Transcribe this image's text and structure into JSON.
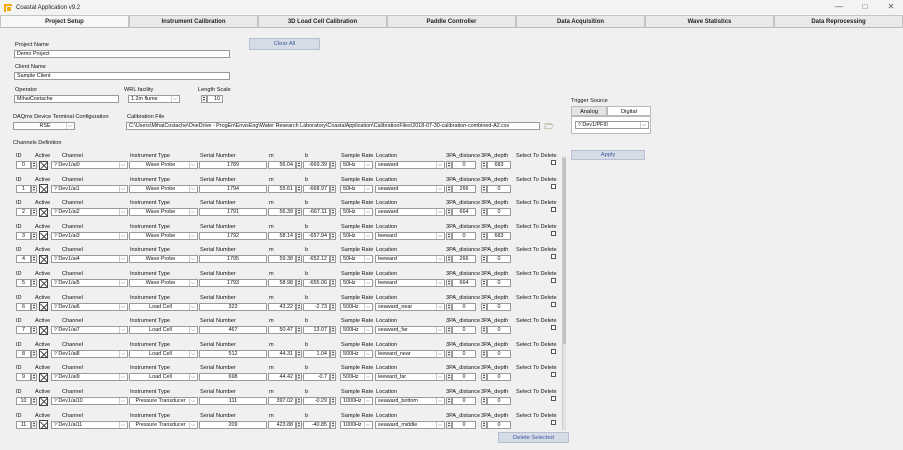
{
  "window": {
    "title": "Coastal Application v9.2",
    "minimize": "—",
    "maximize": "□",
    "close": "✕"
  },
  "tabs": [
    "Project Setup",
    "Instrument Calibration",
    "3D Load Cell Calibration",
    "Paddle Controller",
    "Data Acquisition",
    "Wave Statistics",
    "Data Reprocessing"
  ],
  "project": {
    "name_label": "Project Name",
    "name": "Demo Project",
    "client_label": "Client Name",
    "client": "Sample Client",
    "operator_label": "Operator",
    "operator": "MihaiCostache",
    "facility_label": "WRL facility",
    "facility": "1.2m flume",
    "length_label": "Length Scale",
    "length": "10",
    "clear_all": "Clear All"
  },
  "daq": {
    "label": "DAQmx Device Terminal Configuration",
    "value": "RSE"
  },
  "calibration": {
    "label": "Calibration File",
    "path": "C:\\Users\\MihaiCostache\\OneDrive - ProgEn\\EnvisEng\\Water Research Laboratory\\CoastalApplication\\CalibrationFiles\\2018-07-30-calibration-combined-A2.csv"
  },
  "trigger": {
    "label": "Trigger Source",
    "tab_analog": "Analog",
    "tab_digital": "Digital",
    "channel": "Dev1/PFI0",
    "apply": "Apply"
  },
  "channels": {
    "title": "Channels Definition",
    "headers": {
      "id": "ID",
      "active": "Active",
      "channel": "Channel",
      "instrument": "Instrument Type",
      "serial": "Serial Number",
      "m": "m",
      "b": "b",
      "rate": "Sample Rate",
      "location": "Location",
      "dist": "3PA_distance",
      "depth": "3PA_depth",
      "delete": "Select To Delete"
    },
    "rows": [
      {
        "id": "0",
        "channel": "Dev1/ai0",
        "instrument": "Wave Probe",
        "serial": "1789",
        "m": "56.04",
        "b": "-669.39",
        "rate": "50Hz",
        "location": "seaward",
        "dist": "0",
        "depth": "683"
      },
      {
        "id": "1",
        "channel": "Dev1/ai1",
        "instrument": "Wave Probe",
        "serial": "1794",
        "m": "55.61",
        "b": "-668.97",
        "rate": "50Hz",
        "location": "seaward",
        "dist": "266",
        "depth": "0"
      },
      {
        "id": "2",
        "channel": "Dev1/ai2",
        "instrument": "Wave Probe",
        "serial": "1791",
        "m": "56.39",
        "b": "-667.11",
        "rate": "50Hz",
        "location": "seaward",
        "dist": "664",
        "depth": "0"
      },
      {
        "id": "3",
        "channel": "Dev1/ai3",
        "instrument": "Wave Probe",
        "serial": "1792",
        "m": "58.14",
        "b": "-657.94",
        "rate": "50Hz",
        "location": "leeward",
        "dist": "0",
        "depth": "683"
      },
      {
        "id": "4",
        "channel": "Dev1/ai4",
        "instrument": "Wave Probe",
        "serial": "1795",
        "m": "59.38",
        "b": "-652.12",
        "rate": "50Hz",
        "location": "leeward",
        "dist": "266",
        "depth": "0"
      },
      {
        "id": "5",
        "channel": "Dev1/ai5",
        "instrument": "Wave Probe",
        "serial": "1793",
        "m": "58.98",
        "b": "-655.06",
        "rate": "50Hz",
        "location": "leeward",
        "dist": "664",
        "depth": "0"
      },
      {
        "id": "6",
        "channel": "Dev1/ai6",
        "instrument": "Load Cell",
        "serial": "323",
        "m": "43.22",
        "b": "-2.73",
        "rate": "500Hz",
        "location": "seaward_near",
        "dist": "0",
        "depth": "0"
      },
      {
        "id": "7",
        "channel": "Dev1/ai7",
        "instrument": "Load Cell",
        "serial": "467",
        "m": "50.47",
        "b": "13.07",
        "rate": "500Hz",
        "location": "seaward_far",
        "dist": "0",
        "depth": "0"
      },
      {
        "id": "8",
        "channel": "Dev1/ai8",
        "instrument": "Load Cell",
        "serial": "512",
        "m": "44.31",
        "b": "1.04",
        "rate": "500Hz",
        "location": "leeward_near",
        "dist": "0",
        "depth": "0"
      },
      {
        "id": "9",
        "channel": "Dev1/ai9",
        "instrument": "Load Cell",
        "serial": "698",
        "m": "44.42",
        "b": "-0.7",
        "rate": "500Hz",
        "location": "leeward_far",
        "dist": "0",
        "depth": "0"
      },
      {
        "id": "10",
        "channel": "Dev1/ai10",
        "instrument": "Pressure Transducer",
        "serial": "111",
        "m": "397.02",
        "b": "-0.29",
        "rate": "1000Hz",
        "location": "seaward_bottom",
        "dist": "0",
        "depth": "0"
      },
      {
        "id": "11",
        "channel": "Dev1/ai11",
        "instrument": "Pressure Transducer",
        "serial": "209",
        "m": "423.88",
        "b": "-40.85",
        "rate": "1000Hz",
        "location": "seaward_middle",
        "dist": "0",
        "depth": "0"
      }
    ],
    "delete_selected": "Delete Selected"
  }
}
